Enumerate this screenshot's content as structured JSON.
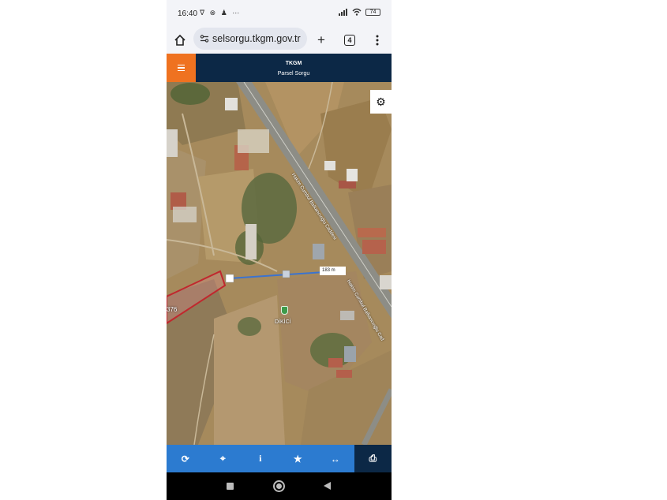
{
  "status_bar": {
    "time": "16:40",
    "left_icons": "ᐁ ⊗ ♟ ⋯",
    "battery": "74"
  },
  "browser": {
    "url": "selsorgu.tkgm.gov.tr",
    "tab_count": "4",
    "icons": [
      "home-icon",
      "site-settings-icon",
      "plus-icon",
      "tabs-icon",
      "more-vertical-icon"
    ]
  },
  "app": {
    "title": "TKGM",
    "subtitle": "Parsel Sorgu",
    "accent_color": "#ef7220",
    "header_color": "#0c2846"
  },
  "map": {
    "distance_label": "183 m",
    "parcel_number": "376",
    "place_label": "DİKİCİ",
    "road_label": "Hakim Cumbul Balkancıoğlu Caddesi",
    "road_label_short": "Hakim Cumbul Balkancıoğlu Cad"
  },
  "toolbar": {
    "refresh": "⟳",
    "locate": "⌖",
    "info": "i",
    "favorite": "★",
    "measure": "↔",
    "print": "⎙",
    "color": "#2c7bd0"
  }
}
